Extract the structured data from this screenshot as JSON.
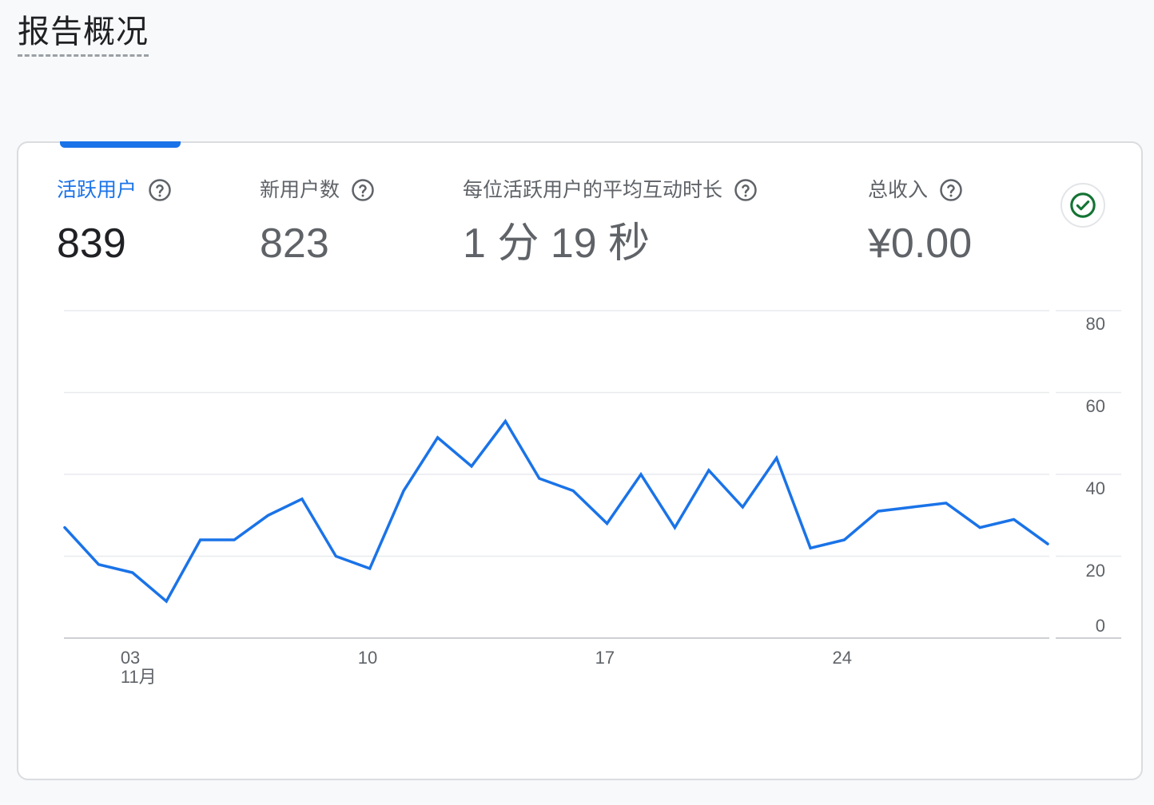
{
  "page": {
    "title": "报告概况"
  },
  "metrics": [
    {
      "label": "活跃用户",
      "value": "839",
      "active": true
    },
    {
      "label": "新用户数",
      "value": "823",
      "active": false
    },
    {
      "label": "每位活跃用户的平均互动时长",
      "value": "1 分 19 秒",
      "active": false
    },
    {
      "label": "总收入",
      "value": "¥0.00",
      "active": false
    }
  ],
  "colors": {
    "accent": "#1a73e8",
    "line": "#1a73e8",
    "status_ok": "#137333"
  },
  "icons": {
    "help": "help-circle-icon",
    "status": "check-circle-icon"
  },
  "chart_data": {
    "type": "line",
    "x_tick_labels": [
      "03",
      "10",
      "17",
      "24"
    ],
    "x_tick_sublabels": [
      "11月",
      "",
      "",
      ""
    ],
    "x_tick_indices": [
      2,
      9,
      16,
      23
    ],
    "y_ticks": [
      "80",
      "60",
      "40",
      "20",
      "0"
    ],
    "ylim": [
      0,
      80
    ],
    "grid": true,
    "series": [
      {
        "values": [
          27,
          18,
          16,
          9,
          24,
          24,
          30,
          34,
          20,
          17,
          36,
          49,
          42,
          53,
          39,
          36,
          28,
          40,
          27,
          41,
          32,
          44,
          22,
          24,
          31,
          32,
          33,
          27,
          29,
          23
        ]
      }
    ]
  }
}
